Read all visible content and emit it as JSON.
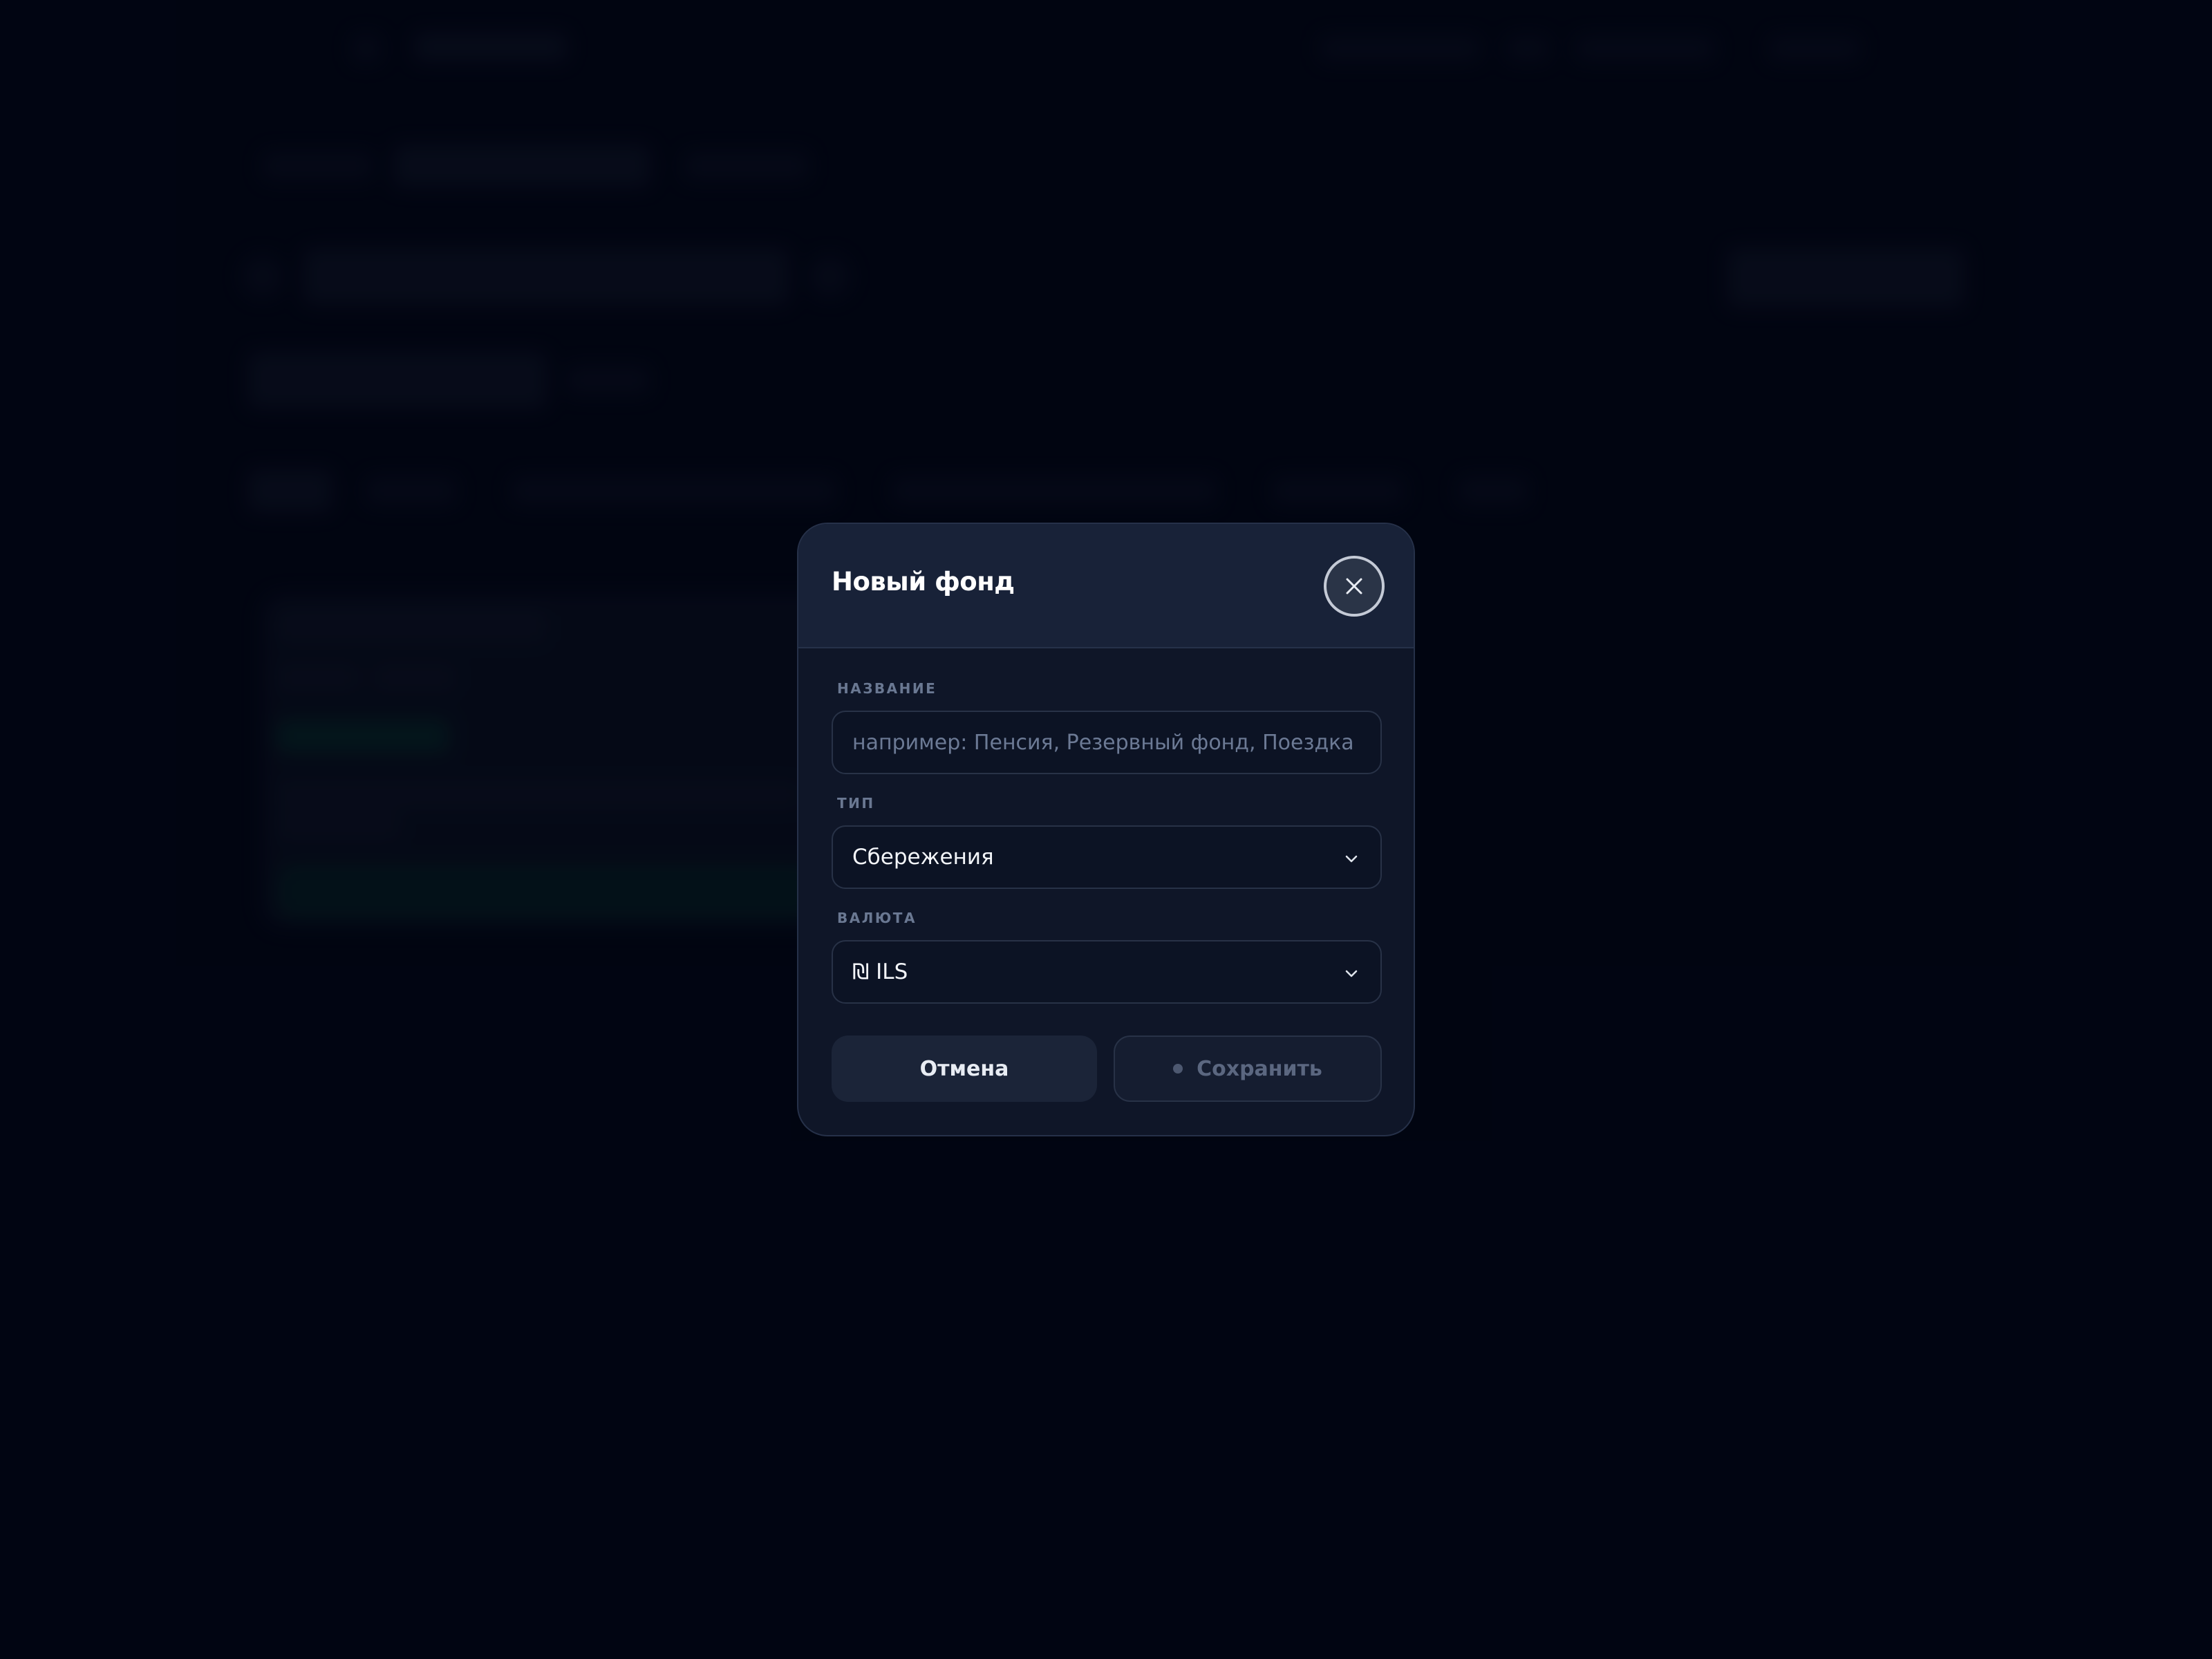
{
  "modal": {
    "title": "Новый фонд",
    "close_icon": "close-icon",
    "fields": {
      "name": {
        "label": "НАЗВАНИЕ",
        "value": "",
        "placeholder": "например: Пенсия, Резервный фонд, Поездка"
      },
      "type": {
        "label": "ТИП",
        "selected": "Сбережения"
      },
      "currency": {
        "label": "ВАЛЮТА",
        "selected": "₪ ILS"
      }
    },
    "buttons": {
      "cancel": "Отмена",
      "save": "Сохранить"
    }
  },
  "colors": {
    "page_background": "#020716",
    "modal_background": "#0f1628",
    "modal_header": "#182238",
    "border": "#263149",
    "label": "#6a7892",
    "text": "#f3f5f9",
    "disabled_text": "#5b6780"
  }
}
